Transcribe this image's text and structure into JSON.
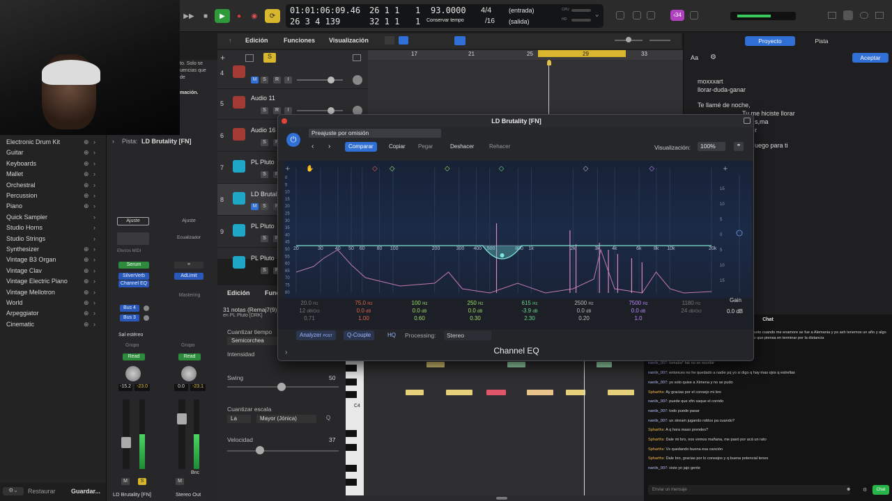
{
  "transport": {
    "time": "01:01:06:09.46",
    "bars_pos": "26 1 1",
    "bars_sub": "1",
    "beats_pos": "26 3 4 139",
    "bars_pos2": "32 1 1",
    "bars_sub2": "1",
    "tempo": "93.0000",
    "tempo_label": "Conservar tempo",
    "signature": "4/4",
    "division": "/16",
    "input_label": "(entrada)",
    "output_label": "(salida)",
    "cpu_label": "CPU",
    "hd_label": "HD",
    "badge": "‹34"
  },
  "menubar": {
    "edit": "Edición",
    "functions": "Funciones",
    "view": "Visualización"
  },
  "library": {
    "header_text": [
      "to. Solo se",
      "uencias que",
      "de",
      "mación."
    ],
    "items": [
      "Electronic Drum Kit",
      "Guitar",
      "Keyboards",
      "Mallet",
      "Orchestral",
      "Percussion",
      "Piano",
      "Quick Sampler",
      "Studio Horns",
      "Studio Strings",
      "Synthesizer",
      "Vintage B3 Organ",
      "Vintage Clav",
      "Vintage Electric Piano",
      "Vintage Mellotron",
      "World",
      "Arpeggiator",
      "Cinematic"
    ],
    "restore": "Restaurar",
    "save": "Guardar..."
  },
  "inspector": {
    "track_label": "Pista:",
    "track_name": "LD Brutality [FN]",
    "ajuste": "Ajuste",
    "ajuste2": "Ajuste",
    "efectos": "Efectos MIDI",
    "ecualizador": "Ecualizador",
    "serum": "Serum",
    "silververb": "SilverVerb",
    "channel_eq": "Channel EQ",
    "adlimit": "AdLimit",
    "mastering": "Mastering",
    "bus4": "Bus 4",
    "bus3": "Bus 3",
    "sal": "Sal estéreo",
    "grupo": "Grupo",
    "grupo2": "Grupo",
    "read": "Read",
    "read2": "Read",
    "vol1": "-15.2",
    "vol1b": "-23.0",
    "vol2": "0.0",
    "vol2b": "-23.1",
    "bnc": "Bnc",
    "strip1_name": "LD Brutality [FN]",
    "strip2_name": "Stereo Out",
    "m": "M",
    "s": "S",
    "m2": "M"
  },
  "tracks": [
    {
      "num": "4",
      "name": ""
    },
    {
      "num": "5",
      "name": "Audio 11"
    },
    {
      "num": "6",
      "name": "Audio 16"
    },
    {
      "num": "7",
      "name": "PL Pluto"
    },
    {
      "num": "8",
      "name": "LD Brutal"
    },
    {
      "num": "9",
      "name": "PL Pluto"
    },
    {
      "num": "",
      "name": "PL Pluto"
    }
  ],
  "ruler": [
    "17",
    "21",
    "25",
    "29",
    "33"
  ],
  "editor": {
    "edit": "Edición",
    "func": "Funci",
    "notes_info": "31 notas (Remaj7(9)",
    "region": "en PL Pluto [DRK]",
    "quantize_time": "Cuantizar tiempo",
    "quantize_val": "Semicorchea",
    "intensity": "Intensidad",
    "swing": "Swing",
    "swing_val": "50",
    "quantize_scale": "Cuantizar escala",
    "scale_root": "La",
    "scale_mode": "Mayor (Jónica)",
    "q": "Q",
    "velocity": "Velocidad",
    "velocity_val": "37",
    "c4": "C4"
  },
  "eq": {
    "window_title": "LD Brutality [FN]",
    "preset": "Preajuste por omisión",
    "compare": "Comparar",
    "copy": "Copiar",
    "paste": "Pegar",
    "undo": "Deshacer",
    "redo": "Rehacer",
    "view_label": "Visualización:",
    "view_val": "100%",
    "freq_labels": [
      "20",
      "30",
      "40",
      "50",
      "60",
      "80",
      "100",
      "200",
      "300",
      "400",
      "500",
      "800",
      "1k",
      "2k",
      "3k",
      "4k",
      "6k",
      "8k",
      "10k",
      "20k"
    ],
    "db_left": [
      "0",
      "5",
      "10",
      "15",
      "20",
      "25",
      "30",
      "35",
      "40",
      "45",
      "50",
      "55",
      "60",
      "65",
      "70",
      "75",
      "80"
    ],
    "db_right": [
      "15",
      "10",
      "5",
      "0",
      "5",
      "10",
      "15"
    ],
    "gain_label": "Gain",
    "gain_val": "0.0 dB",
    "bands": [
      {
        "freq": "20.0",
        "unit": "Hz",
        "gain": "12",
        "gunit": "dB/Oct",
        "q": "0.71",
        "color": "#8a8a8a"
      },
      {
        "freq": "75.0",
        "unit": "Hz",
        "gain": "0.0",
        "gunit": "dB",
        "q": "1.00",
        "color": "#e2654f"
      },
      {
        "freq": "100",
        "unit": "Hz",
        "gain": "0.0",
        "gunit": "dB",
        "q": "0.60",
        "color": "#9fe26a"
      },
      {
        "freq": "250",
        "unit": "Hz",
        "gain": "0.0",
        "gunit": "dB",
        "q": "0.30",
        "color": "#9fe26a"
      },
      {
        "freq": "615",
        "unit": "Hz",
        "gain": "-3.9",
        "gunit": "dB",
        "q": "2.30",
        "color": "#6ad98c"
      },
      {
        "freq": "2500",
        "unit": "Hz",
        "gain": "0.0",
        "gunit": "dB",
        "q": "0.20",
        "color": "#bdbdbd"
      },
      {
        "freq": "7500",
        "unit": "Hz",
        "gain": "0.0",
        "gunit": "dB",
        "q": "1.0",
        "color": "#c089ff"
      },
      {
        "freq": "1180",
        "unit": "Hz",
        "gain": "24",
        "gunit": "dB/Oct",
        "q": "",
        "color": "#8a8a8a"
      }
    ],
    "analyzer": "Analyzer",
    "analyzer_post": "POST",
    "qcouple": "Q-Couple",
    "hq": "HQ",
    "processing": "Processing:",
    "processing_val": "Stereo",
    "plugin_name": "Channel EQ"
  },
  "right_panel": {
    "tab1": "Proyecto",
    "tab2": "Pista",
    "aa": "Aa",
    "accept": "Aceptar",
    "lyrics": [
      "moxxxart",
      "llorar-duda-ganar",
      "Te llamé de noche,",
      "Tu me hiciste llorar",
      "s,ma",
      "r",
      "uego para ti"
    ]
  },
  "chat": {
    "title": "Chat",
    "input_placeholder": "Enviar un mensaje",
    "send": "Chat",
    "messages": [
      {
        "user": "Spharths:",
        "text": " Ella es ecuatoriana y la conoci aca en Colombia y justo cuando me enamore se fue a Alemania y ps ash tenemos un año y algo de relación a distancia pero igual ya voy que lo esta afectando que piensa en terminar por la distancia"
      },
      {
        "user": "Spharths:",
        "text": " Coño"
      },
      {
        "user": "nanilx_007:",
        "text": " se tomana foto a media chuela"
      },
      {
        "user": "nanilx_007:",
        "text": " tomaba* fak no se escribir"
      },
      {
        "user": "nanilx_007:",
        "text": " entonces no he quedado a nadie pq yo si digo q hay mas ojos q estrellas"
      },
      {
        "user": "nanilx_007:",
        "text": " yo solo quise a Ximena y no se pudo"
      },
      {
        "user": "Spharths:",
        "text": " Ay gracias por el consejo mi bro"
      },
      {
        "user": "nanilx_007:",
        "text": " puede que xfin saque el corrido"
      },
      {
        "user": "nanilx_007:",
        "text": " todo puede pasar"
      },
      {
        "user": "nanilx_007:",
        "text": " un stream jugando roblox pa cuando?"
      },
      {
        "user": "Spharths:",
        "text": " A q hora maso prendes?"
      },
      {
        "user": "Spharths:",
        "text": " Dale mi bro, nos vemos mañana, me pasó por acá un rato"
      },
      {
        "user": "Spharths:",
        "text": " Vs quedando buena esa canción"
      },
      {
        "user": "Spharths:",
        "text": " Dale bro, gracias por lo consejos y q buena potencial tenes"
      },
      {
        "user": "nanilx_007:",
        "text": " viste yo jajo gente"
      }
    ]
  }
}
